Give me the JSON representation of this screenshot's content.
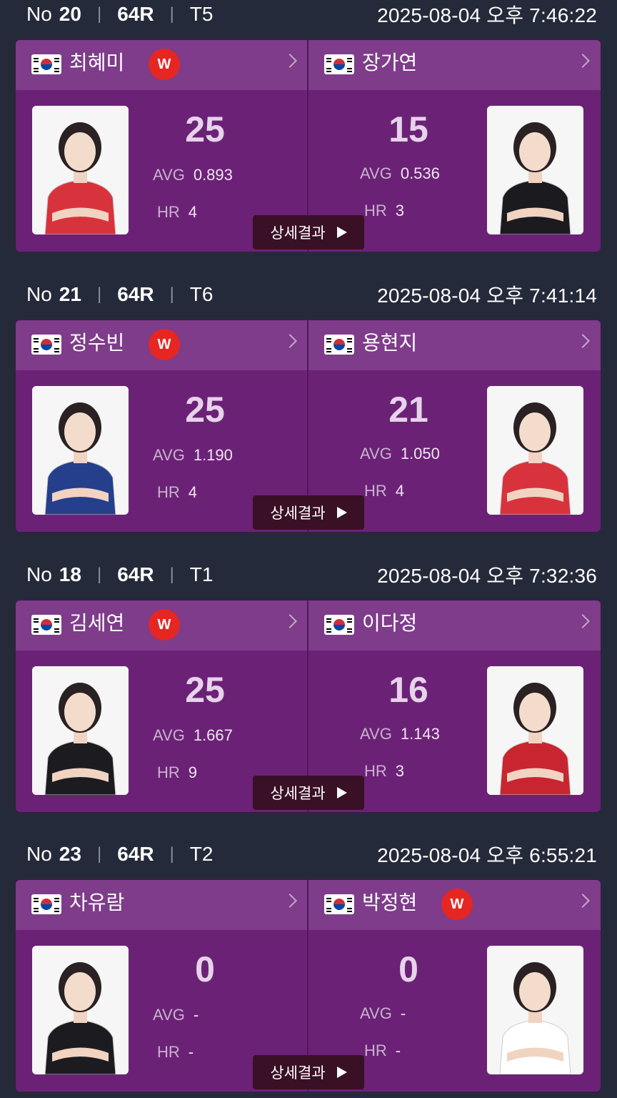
{
  "matches": [
    {
      "no_label": "No",
      "no": "20",
      "round": "64R",
      "table": "T5",
      "timestamp": "2025-08-04 오후 7:46:22",
      "left": {
        "name": "최혜미",
        "winner": true,
        "winner_label": "W",
        "score": "25",
        "avg_label": "AVG",
        "avg": "0.893",
        "hr_label": "HR",
        "hr": "4",
        "shirt_color": "#d8333d"
      },
      "right": {
        "name": "장가연",
        "winner": false,
        "winner_label": "W",
        "score": "15",
        "avg_label": "AVG",
        "avg": "0.536",
        "hr_label": "HR",
        "hr": "3",
        "shirt_color": "#1b1b1f"
      },
      "detail_label": "상세결과"
    },
    {
      "no_label": "No",
      "no": "21",
      "round": "64R",
      "table": "T6",
      "timestamp": "2025-08-04 오후 7:41:14",
      "left": {
        "name": "정수빈",
        "winner": true,
        "winner_label": "W",
        "score": "25",
        "avg_label": "AVG",
        "avg": "1.190",
        "hr_label": "HR",
        "hr": "4",
        "shirt_color": "#263f8c"
      },
      "right": {
        "name": "용현지",
        "winner": false,
        "winner_label": "W",
        "score": "21",
        "avg_label": "AVG",
        "avg": "1.050",
        "hr_label": "HR",
        "hr": "4",
        "shirt_color": "#d8333d"
      },
      "detail_label": "상세결과"
    },
    {
      "no_label": "No",
      "no": "18",
      "round": "64R",
      "table": "T1",
      "timestamp": "2025-08-04 오후 7:32:36",
      "left": {
        "name": "김세연",
        "winner": true,
        "winner_label": "W",
        "score": "25",
        "avg_label": "AVG",
        "avg": "1.667",
        "hr_label": "HR",
        "hr": "9",
        "shirt_color": "#1c1c20"
      },
      "right": {
        "name": "이다정",
        "winner": false,
        "winner_label": "W",
        "score": "16",
        "avg_label": "AVG",
        "avg": "1.143",
        "hr_label": "HR",
        "hr": "3",
        "shirt_color": "#c92530"
      },
      "detail_label": "상세결과"
    },
    {
      "no_label": "No",
      "no": "23",
      "round": "64R",
      "table": "T2",
      "timestamp": "2025-08-04 오후 6:55:21",
      "left": {
        "name": "차유람",
        "winner": false,
        "winner_label": "W",
        "score": "0",
        "avg_label": "AVG",
        "avg": "-",
        "hr_label": "HR",
        "hr": "-",
        "shirt_color": "#1c1c20"
      },
      "right": {
        "name": "박정현",
        "winner": true,
        "winner_label": "W",
        "score": "0",
        "avg_label": "AVG",
        "avg": "-",
        "hr_label": "HR",
        "hr": "-",
        "shirt_color": "#ffffff"
      },
      "detail_label": "상세결과"
    }
  ]
}
